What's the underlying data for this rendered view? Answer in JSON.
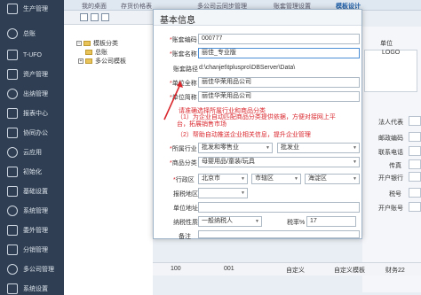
{
  "sidebar": {
    "items": [
      {
        "label": "生产管理",
        "icon": "factory-icon"
      },
      {
        "label": "总账",
        "icon": "ledger-icon"
      },
      {
        "label": "T-UFO",
        "icon": "ufo-report-icon"
      },
      {
        "label": "资产管理",
        "icon": "asset-icon"
      },
      {
        "label": "出纳管理",
        "icon": "cashier-icon"
      },
      {
        "label": "报表中心",
        "icon": "report-icon"
      },
      {
        "label": "协同办公",
        "icon": "collaboration-icon"
      },
      {
        "label": "云应用",
        "icon": "cloud-icon"
      },
      {
        "label": "初始化",
        "icon": "init-icon"
      },
      {
        "label": "基础设置",
        "icon": "settings-icon"
      },
      {
        "label": "系统管理",
        "icon": "system-icon"
      },
      {
        "label": "委外管理",
        "icon": "outsource-icon"
      },
      {
        "label": "分销管理",
        "icon": "distribution-icon"
      },
      {
        "label": "多公司管理",
        "icon": "multi-company-icon"
      },
      {
        "label": "系统设置",
        "icon": "system-settings-icon"
      }
    ]
  },
  "tabs": [
    "我的桌面",
    "存货价格表",
    "多公司云同步管理",
    "账套管理设置",
    "模板设计"
  ],
  "tree": {
    "root": "模板分类",
    "children": [
      "总账",
      "多公司模板"
    ]
  },
  "modal": {
    "title": "基本信息",
    "account_code_label": "账套编码",
    "account_code_value": "000777",
    "account_name_label": "账套名称",
    "account_name_value": "丽佳_专业版",
    "account_path_label": "账套路径",
    "account_path_value": "d:\\chanjet\\tplusprо\\DBServer\\Data\\",
    "unit_fullname_label": "单位全称",
    "unit_fullname_value": "丽佳华荣用品公司",
    "unit_shortname_label": "单位简称",
    "unit_shortname_value": "丽佳华荣用品公司",
    "hint_title": "请准确选择所属行业和商品分类",
    "hint_line1": "（1）为企业自动匹配商品分类提供依据，方便对接网上平台，拓展销售市场",
    "hint_line2": "（2）帮助自动推送企业相关信息，提升企业管理",
    "industry_label": "所属行业",
    "industry_value1": "批发和零售业",
    "industry_value2": "批发业",
    "category_label": "商品分类",
    "category_value": "母婴用品/童装/玩具",
    "region_label": "行政区",
    "region_province": "北京市",
    "region_city": "市辖区",
    "region_district": "海淀区",
    "tax_region_label": "报税地区",
    "address_label": "单位地址",
    "taxpayer_label": "纳税性质",
    "taxpayer_value": "一般纳税人",
    "tax_rate_label": "税率%",
    "tax_rate_value": "17",
    "remark_label": "备注"
  },
  "right_panel": {
    "unit_label": "单位",
    "logo_label": "LOGO",
    "fields": [
      "法人代表",
      "邮政编码",
      "联系电话",
      "传真",
      "开户银行",
      "税号",
      "开户账号"
    ]
  },
  "bottom_row": {
    "col1": "100",
    "col2": "001",
    "col3": "自定义",
    "col4": "自定义模板",
    "col5": "财务22"
  },
  "colors": {
    "sidebar_bg": "#2f3e52",
    "accent": "#1f5fa8",
    "hint_red": "#d9262c"
  }
}
